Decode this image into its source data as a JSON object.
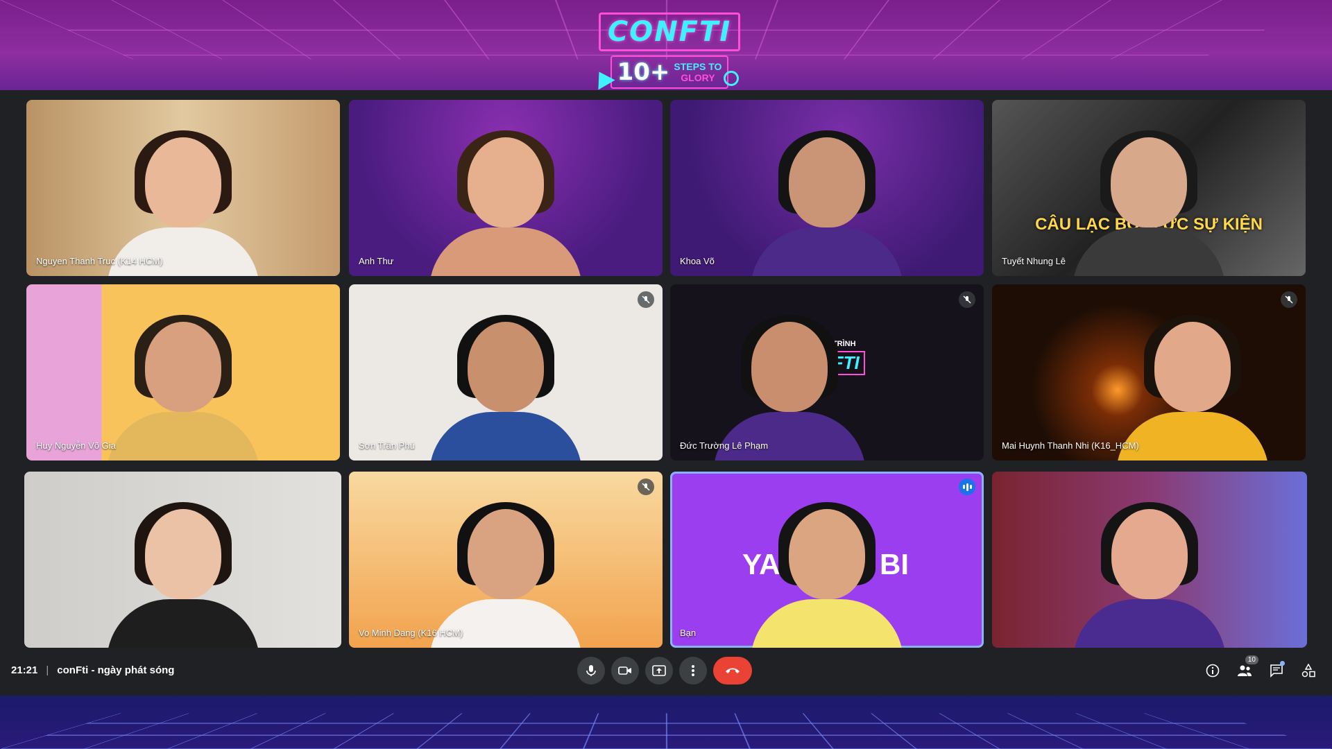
{
  "banner": {
    "logo_title": "CONFTI",
    "logo_number": "10+",
    "logo_steps_line1": "STEPS TO",
    "logo_steps_line2": "GLORY"
  },
  "participants": [
    {
      "name": "Nguyen Thanh Truc (K14 HCM)",
      "muted": false,
      "speaking": false
    },
    {
      "name": "Anh Thư",
      "muted": false,
      "speaking": false
    },
    {
      "name": "Khoa Võ",
      "muted": false,
      "speaking": false
    },
    {
      "name": "Tuyết Nhung Lê",
      "muted": false,
      "speaking": false
    },
    {
      "name": "Huy Nguyễn Võ Gia",
      "muted": false,
      "speaking": false
    },
    {
      "name": "Sơn Trần Phú",
      "muted": true,
      "speaking": false
    },
    {
      "name": "Đức Trường Lê Phạm",
      "muted": true,
      "speaking": false
    },
    {
      "name": "Mai Huynh Thanh Nhi (K16_HCM)",
      "muted": true,
      "speaking": false
    },
    {
      "name": "",
      "muted": false,
      "speaking": false
    },
    {
      "name": "Vo Minh Dang (K16 HCM)",
      "muted": true,
      "speaking": false
    },
    {
      "name": "Bạn",
      "muted": false,
      "speaking": true
    },
    {
      "name": "",
      "muted": false,
      "speaking": false
    }
  ],
  "tile_backgrounds": {
    "t1": "#c9a880",
    "t2": "#5a1d88",
    "t3": "#4a1f7e",
    "t4": "#3a3a3a",
    "t5": "#f7c35a",
    "t6": "#ece9e4",
    "t7": "#16121c",
    "t8": "#1d0d05",
    "t9": "#d9d7d4",
    "t10": "#f2b25e",
    "t11": "#9b3ef0",
    "t12": "#8a3a72"
  },
  "tile_overlays": {
    "t4_text": "CÂU LẠC BỘ ... ỨC SỰ KIỆN",
    "t7_label": "CHƯƠNG TRÌNH",
    "t7_logo": "CONFTI",
    "t11_text_left": "YA",
    "t11_text_right": "BI"
  },
  "bottom_bar": {
    "time": "21:21",
    "separator": "|",
    "meeting_title": "conFti - ngày phát sóng",
    "participants_count": "10"
  },
  "icons": {
    "mic": "mic-icon",
    "camera": "camera-icon",
    "present": "present-icon",
    "more": "more-icon",
    "hangup": "hangup-icon",
    "info": "info-icon",
    "people": "people-icon",
    "chat": "chat-icon",
    "activities": "activities-icon"
  },
  "colors": {
    "meet_bg": "#202124",
    "control_bg": "#3c4043",
    "hangup": "#ea4335",
    "active_speaker": "#1a73e8"
  }
}
